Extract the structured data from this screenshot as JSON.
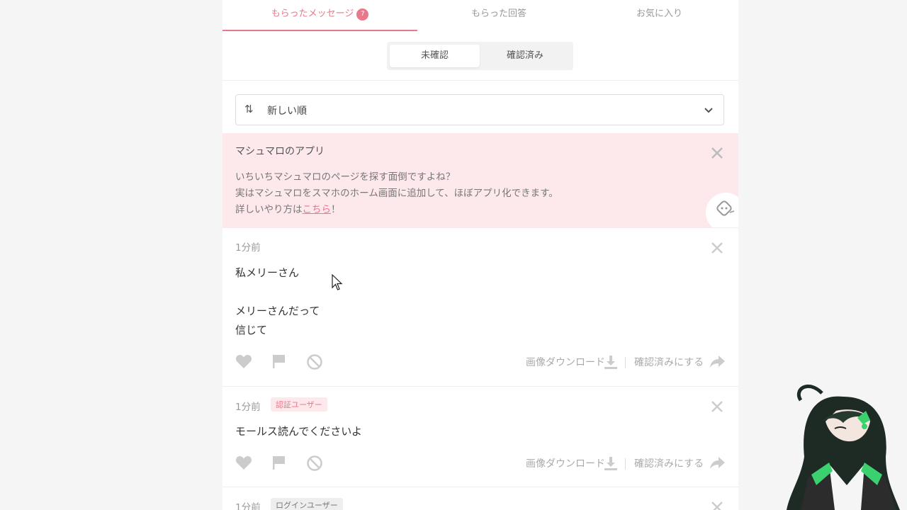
{
  "tabs": [
    {
      "label": "もらったメッセージ",
      "badge": "7",
      "active": true
    },
    {
      "label": "もらった回答",
      "active": false
    },
    {
      "label": "お気に入り",
      "active": false
    }
  ],
  "segmented": {
    "unconfirmed": "未確認",
    "confirmed": "確認済み",
    "active": "unconfirmed"
  },
  "sort": {
    "icon": "sort-arrows-icon",
    "label": "新しい順"
  },
  "promo": {
    "title": "マシュマロのアプリ",
    "line1": "いちいちマシュマロのページを探す面倒ですよね？",
    "line2": "実はマシュマロをスマホのホーム画面に追加して、ほぼアプリ化できます。",
    "line3_prefix": "詳しいやり方は",
    "line3_link": "こちら",
    "line3_suffix": "！"
  },
  "messages": [
    {
      "time": "1分前",
      "tag": "",
      "text": "私メリーさん\n\nメリーさんだって\n信じて",
      "download_label": "画像ダウンロード",
      "confirm_label": "確認済みにする"
    },
    {
      "time": "1分前",
      "tag": "認証ユーザー",
      "text": "モールス読んでくださいよ",
      "download_label": "画像ダウンロード",
      "confirm_label": "確認済みにする"
    },
    {
      "time": "1分前",
      "tag": "ログインユーザー",
      "text": "",
      "download_label": "",
      "confirm_label": ""
    }
  ],
  "colors": {
    "accent": "#e8788c",
    "promo_bg": "#fde8ec",
    "page_bg": "#f5f5f5"
  }
}
